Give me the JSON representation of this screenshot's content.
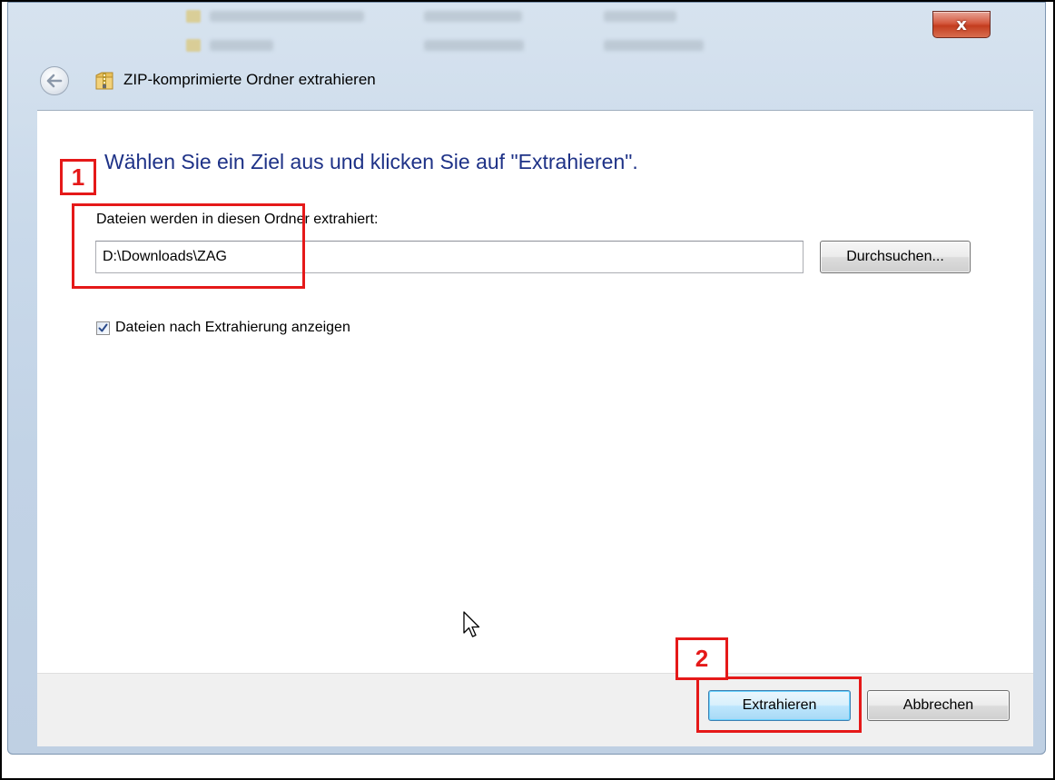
{
  "window": {
    "title": "ZIP-komprimierte Ordner extrahieren",
    "close_label": "x"
  },
  "content": {
    "heading": "Wählen Sie ein Ziel aus und klicken Sie auf \"Extrahieren\".",
    "destination_label": "Dateien werden in diesen Ordner extrahiert:",
    "destination_value": "D:\\Downloads\\ZAG",
    "browse_label": "Durchsuchen...",
    "show_files_label": "Dateien nach Extrahierung anzeigen",
    "show_files_checked": true
  },
  "footer": {
    "extract_label": "Extrahieren",
    "cancel_label": "Abbrechen"
  },
  "annotations": {
    "step1": "1",
    "step2": "2",
    "color": "#e51919"
  },
  "icons": {
    "back": "back-arrow-icon",
    "title": "zip-folder-icon",
    "close": "close-icon",
    "checkbox": "checkmark-icon",
    "cursor": "mouse-pointer-icon"
  },
  "colors": {
    "heading": "#1e3287",
    "close_button": "#c33d1f",
    "default_button_border": "#3c7fb1"
  }
}
